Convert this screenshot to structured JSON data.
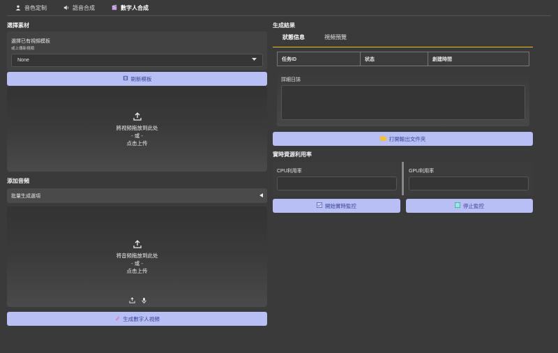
{
  "tabs": [
    {
      "label": "音色定制",
      "icon": "person-icon"
    },
    {
      "label": "語音合成",
      "icon": "speaker-icon"
    },
    {
      "label": "數字人合成",
      "icon": "film-icon"
    }
  ],
  "left": {
    "material_title": "選擇素材",
    "template_label": "選擇已有視頻模板",
    "template_sublabel": "或上傳新視頻",
    "template_value": "None",
    "refresh_button": "刷新模板",
    "video_drop": {
      "line1": "將视频拖放到此处",
      "line2": "- 或 -",
      "line3": "点击上传"
    },
    "audio_title": "添加音頻",
    "batch_label": "批量生成選項",
    "audio_drop": {
      "line1": "将音频拖放到此处",
      "line2": "- 或 -",
      "line3": "点击上传"
    },
    "generate_button": "生成數字人視頻"
  },
  "right": {
    "result_title": "生成結果",
    "result_tabs": [
      "狀態信息",
      "視頻預覽"
    ],
    "table_headers": [
      "任务ID",
      "状态",
      "創建時間"
    ],
    "log_label": "詳細日誌",
    "open_folder_button": "打開輸出文件夾",
    "resource_title": "實時資源利用率",
    "cpu_label": "CPU利用率",
    "gpu_label": "GPU利用率",
    "start_monitor_button": "開始實時監控",
    "stop_monitor_button": "停止監控"
  },
  "colors": {
    "accent": "#b7bff5",
    "accent_text": "#3d4496",
    "tab_underline": "#f0c020"
  }
}
